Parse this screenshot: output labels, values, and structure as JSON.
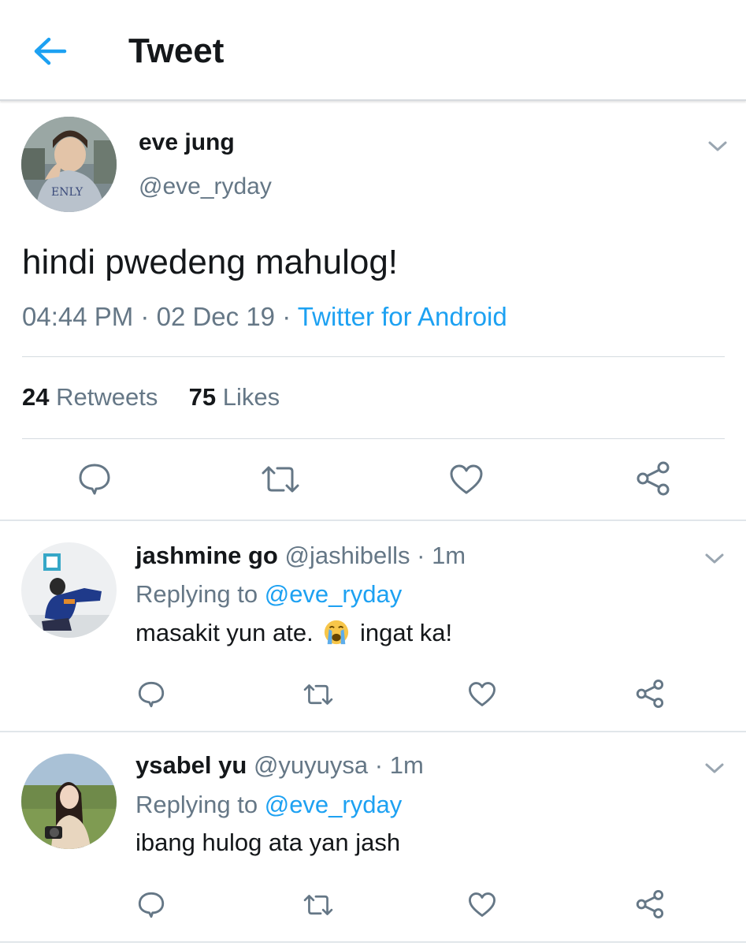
{
  "header": {
    "title": "Tweet"
  },
  "tweet": {
    "name": "eve jung",
    "handle": "@eve_ryday",
    "text": "hindi pwedeng mahulog!",
    "time": "04:44 PM",
    "date": "02 Dec 19",
    "sep": "·",
    "source": "Twitter for Android",
    "retweets_count": "24",
    "retweets_label": "Retweets",
    "likes_count": "75",
    "likes_label": "Likes"
  },
  "replies": [
    {
      "name": "jashmine go",
      "handle": "@jashibells",
      "sep": "·",
      "time": "1m",
      "replying_label": "Replying to",
      "replying_to": "@eve_ryday",
      "text_before": "masakit yun ate.",
      "emoji": "loudly-crying-face",
      "text_after": "ingat ka!"
    },
    {
      "name": "ysabel yu",
      "handle": "@yuyuysa",
      "sep": "·",
      "time": "1m",
      "replying_label": "Replying to",
      "replying_to": "@eve_ryday",
      "text": "ibang hulog ata yan jash"
    }
  ],
  "colors": {
    "accent": "#1da1f2",
    "muted": "#657786",
    "text": "#14171a",
    "icon": "#657786"
  }
}
